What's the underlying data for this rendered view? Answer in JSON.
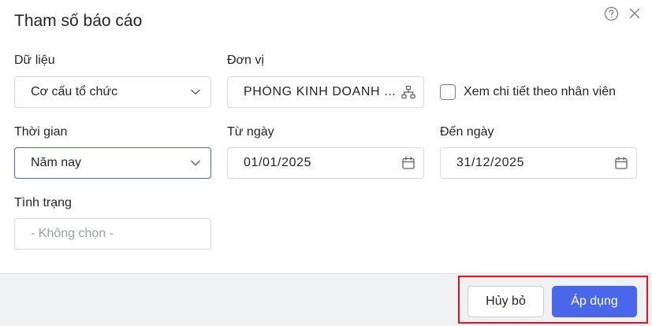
{
  "dialog": {
    "title": "Tham số báo cáo"
  },
  "fields": {
    "data": {
      "label": "Dữ liệu",
      "value": "Cơ cấu tổ chức"
    },
    "unit": {
      "label": "Đơn vị",
      "value": "PHÒNG KINH DOANH ..."
    },
    "detail_checkbox": {
      "label": "Xem chi tiết theo nhân viên",
      "checked": false
    },
    "period": {
      "label": "Thời gian",
      "value": "Năm nay"
    },
    "from_date": {
      "label": "Từ ngày",
      "value": "01/01/2025"
    },
    "to_date": {
      "label": "Đến ngày",
      "value": "31/12/2025"
    },
    "status": {
      "label": "Tình trạng",
      "placeholder": "- Không chọn -"
    }
  },
  "footer": {
    "cancel_label": "Hủy bỏ",
    "apply_label": "Áp dụng"
  },
  "colors": {
    "primary": "#4a66eb",
    "highlight": "#e3141a",
    "footer_bg": "#f0f1f4"
  }
}
